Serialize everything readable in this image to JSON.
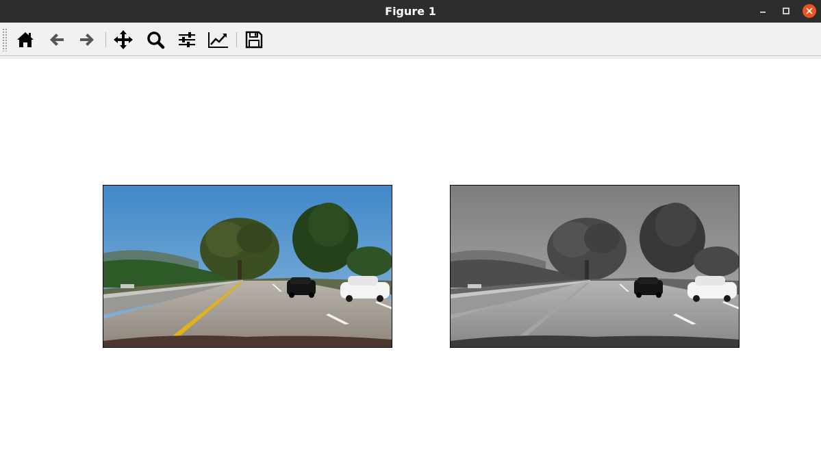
{
  "window": {
    "title": "Figure 1"
  },
  "window_controls": {
    "minimize_icon": "minimize-icon",
    "maximize_icon": "maximize-icon",
    "close_icon": "close-icon",
    "close_color": "#e95420"
  },
  "toolbar": {
    "buttons": [
      {
        "icon": "home-icon"
      },
      {
        "icon": "arrow-left-icon"
      },
      {
        "icon": "arrow-right-icon"
      },
      {
        "icon": "move-arrows-icon"
      },
      {
        "icon": "magnifier-icon"
      },
      {
        "icon": "sliders-icon"
      },
      {
        "icon": "line-chart-icon"
      },
      {
        "icon": "floppy-disk-icon"
      }
    ]
  },
  "figure": {
    "panels": [
      {
        "content": "road-scene-color-photo"
      },
      {
        "content": "road-scene-grayscale-photo"
      }
    ]
  }
}
